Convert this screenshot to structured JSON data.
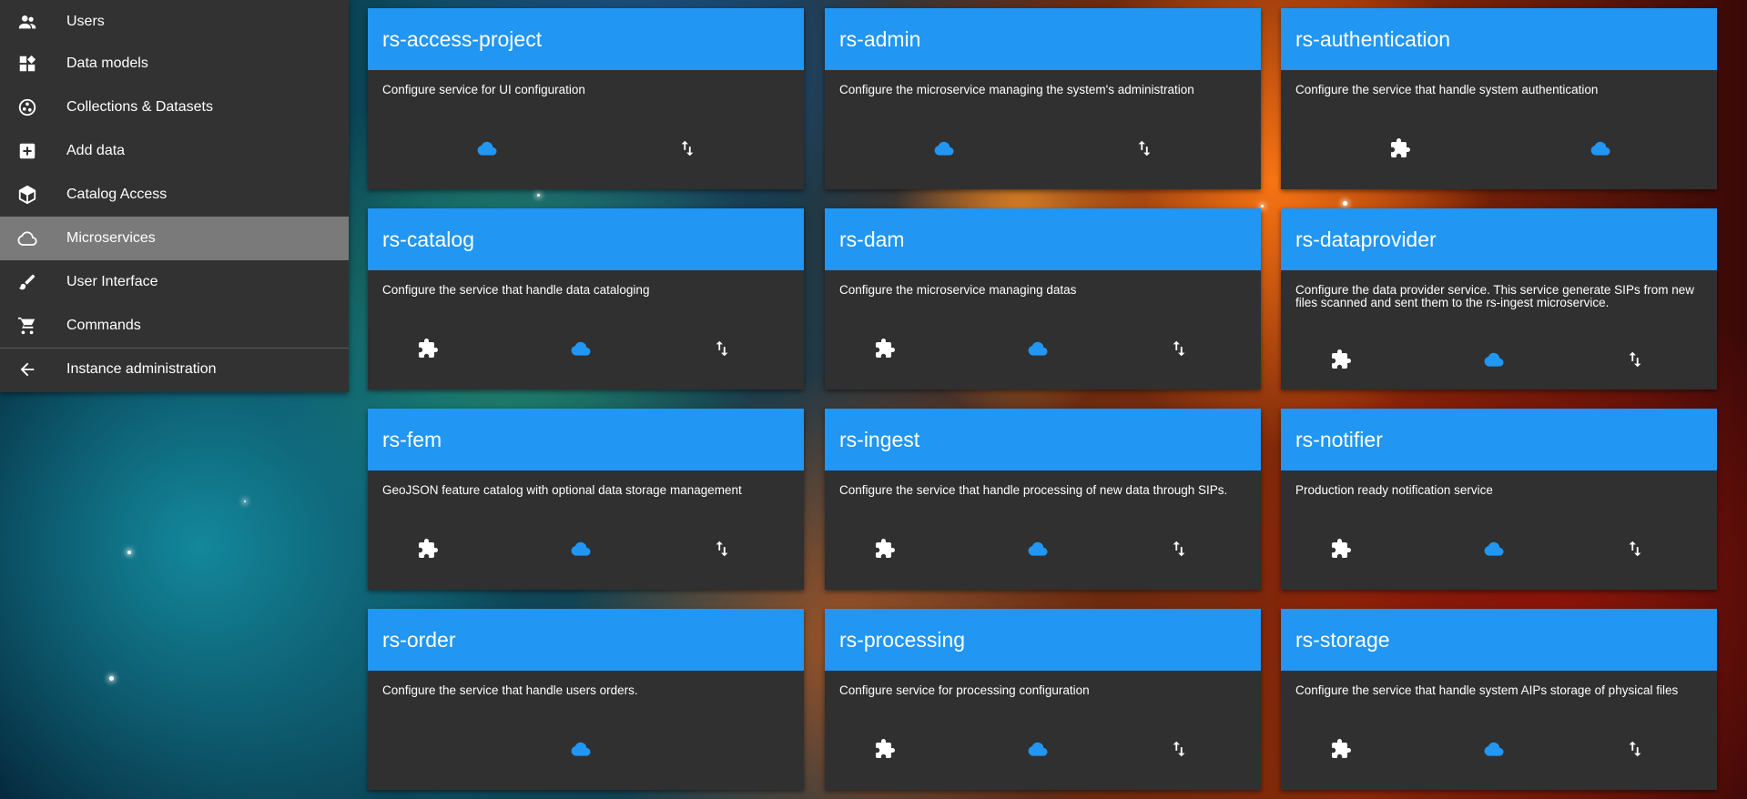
{
  "sidebar": {
    "items": [
      {
        "label": "Users",
        "icon": "users-icon",
        "active": false
      },
      {
        "label": "Data models",
        "icon": "dashboard-icon",
        "active": false
      },
      {
        "label": "Collections & Datasets",
        "icon": "bubbles-icon",
        "active": false
      },
      {
        "label": "Add data",
        "icon": "add-box-icon",
        "active": false
      },
      {
        "label": "Catalog Access",
        "icon": "cube-icon",
        "active": false
      },
      {
        "label": "Microservices",
        "icon": "cloud-outline-icon",
        "active": true
      },
      {
        "label": "User Interface",
        "icon": "brush-icon",
        "active": false
      },
      {
        "label": "Commands",
        "icon": "cart-icon",
        "active": false
      },
      {
        "label": "Instance administration",
        "icon": "arrow-back-icon",
        "active": false
      }
    ]
  },
  "colors": {
    "accent": "#2196f3",
    "card_bg": "#303030",
    "sidebar_bg": "#323232",
    "sidebar_active": "#7a7a7a"
  },
  "microservices": [
    {
      "name": "rs-access-project",
      "description": "Configure service for UI configuration",
      "actions": [
        "cloud-icon",
        "swap-vert-icon"
      ]
    },
    {
      "name": "rs-admin",
      "description": "Configure the microservice managing the system's administration",
      "actions": [
        "cloud-icon",
        "swap-vert-icon"
      ]
    },
    {
      "name": "rs-authentication",
      "description": "Configure the service that handle system authentication",
      "actions": [
        "puzzle-icon",
        "cloud-icon"
      ]
    },
    {
      "name": "rs-catalog",
      "description": "Configure the service that handle data cataloging",
      "actions": [
        "puzzle-icon",
        "cloud-icon",
        "swap-vert-icon"
      ]
    },
    {
      "name": "rs-dam",
      "description": "Configure the microservice managing datas",
      "actions": [
        "puzzle-icon",
        "cloud-icon",
        "swap-vert-icon"
      ]
    },
    {
      "name": "rs-dataprovider",
      "description": "Configure the data provider service. This service generate SIPs from new files scanned and sent them to the rs-ingest microservice.",
      "actions": [
        "puzzle-icon",
        "cloud-icon",
        "swap-vert-icon"
      ]
    },
    {
      "name": "rs-fem",
      "description": "GeoJSON feature catalog with optional data storage management",
      "actions": [
        "puzzle-icon",
        "cloud-icon",
        "swap-vert-icon"
      ]
    },
    {
      "name": "rs-ingest",
      "description": "Configure the service that handle processing of new data through SIPs.",
      "actions": [
        "puzzle-icon",
        "cloud-icon",
        "swap-vert-icon"
      ]
    },
    {
      "name": "rs-notifier",
      "description": "Production ready notification service",
      "actions": [
        "puzzle-icon",
        "cloud-icon",
        "swap-vert-icon"
      ]
    },
    {
      "name": "rs-order",
      "description": "Configure the service that handle users orders.",
      "actions": [
        "cloud-icon"
      ]
    },
    {
      "name": "rs-processing",
      "description": "Configure service for processing configuration",
      "actions": [
        "puzzle-icon",
        "cloud-icon",
        "swap-vert-icon"
      ]
    },
    {
      "name": "rs-storage",
      "description": "Configure the service that handle system AIPs storage of physical files",
      "actions": [
        "puzzle-icon",
        "cloud-icon",
        "swap-vert-icon"
      ]
    }
  ]
}
